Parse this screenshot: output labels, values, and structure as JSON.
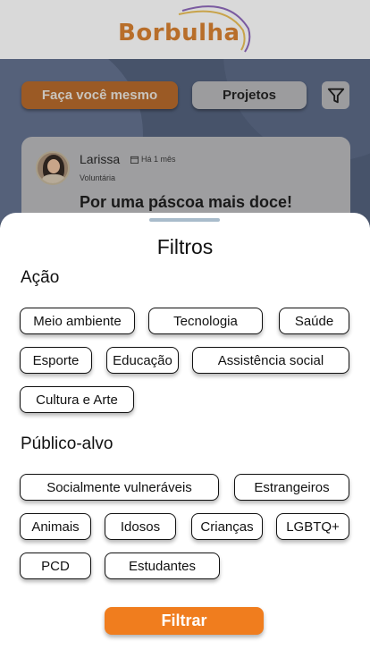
{
  "app": {
    "logo": "Borbulha",
    "tabs": {
      "diy": "Faça você mesmo",
      "projects": "Projetos"
    },
    "filter_icon": "filter-icon"
  },
  "post": {
    "author": "Larissa",
    "time": "Há 1 mês",
    "role": "Voluntária",
    "title": "Por uma páscoa mais doce!"
  },
  "sheet": {
    "title": "Filtros",
    "action_section": "Ação",
    "action_chips": [
      "Meio ambiente",
      "Tecnologia",
      "Saúde",
      "Esporte",
      "Educação",
      "Assistência social",
      "Cultura e Arte"
    ],
    "audience_section": "Público-alvo",
    "audience_chips": [
      "Socialmente vulneráveis",
      "Estrangeiros",
      "Animais",
      "Idosos",
      "Crianças",
      "LGBTQ+",
      "PCD",
      "Estudantes"
    ],
    "submit": "Filtrar"
  },
  "colors": {
    "accent": "#f07d1e",
    "overlay_bg": "#47536a",
    "sheet_bg": "#ffffff"
  }
}
